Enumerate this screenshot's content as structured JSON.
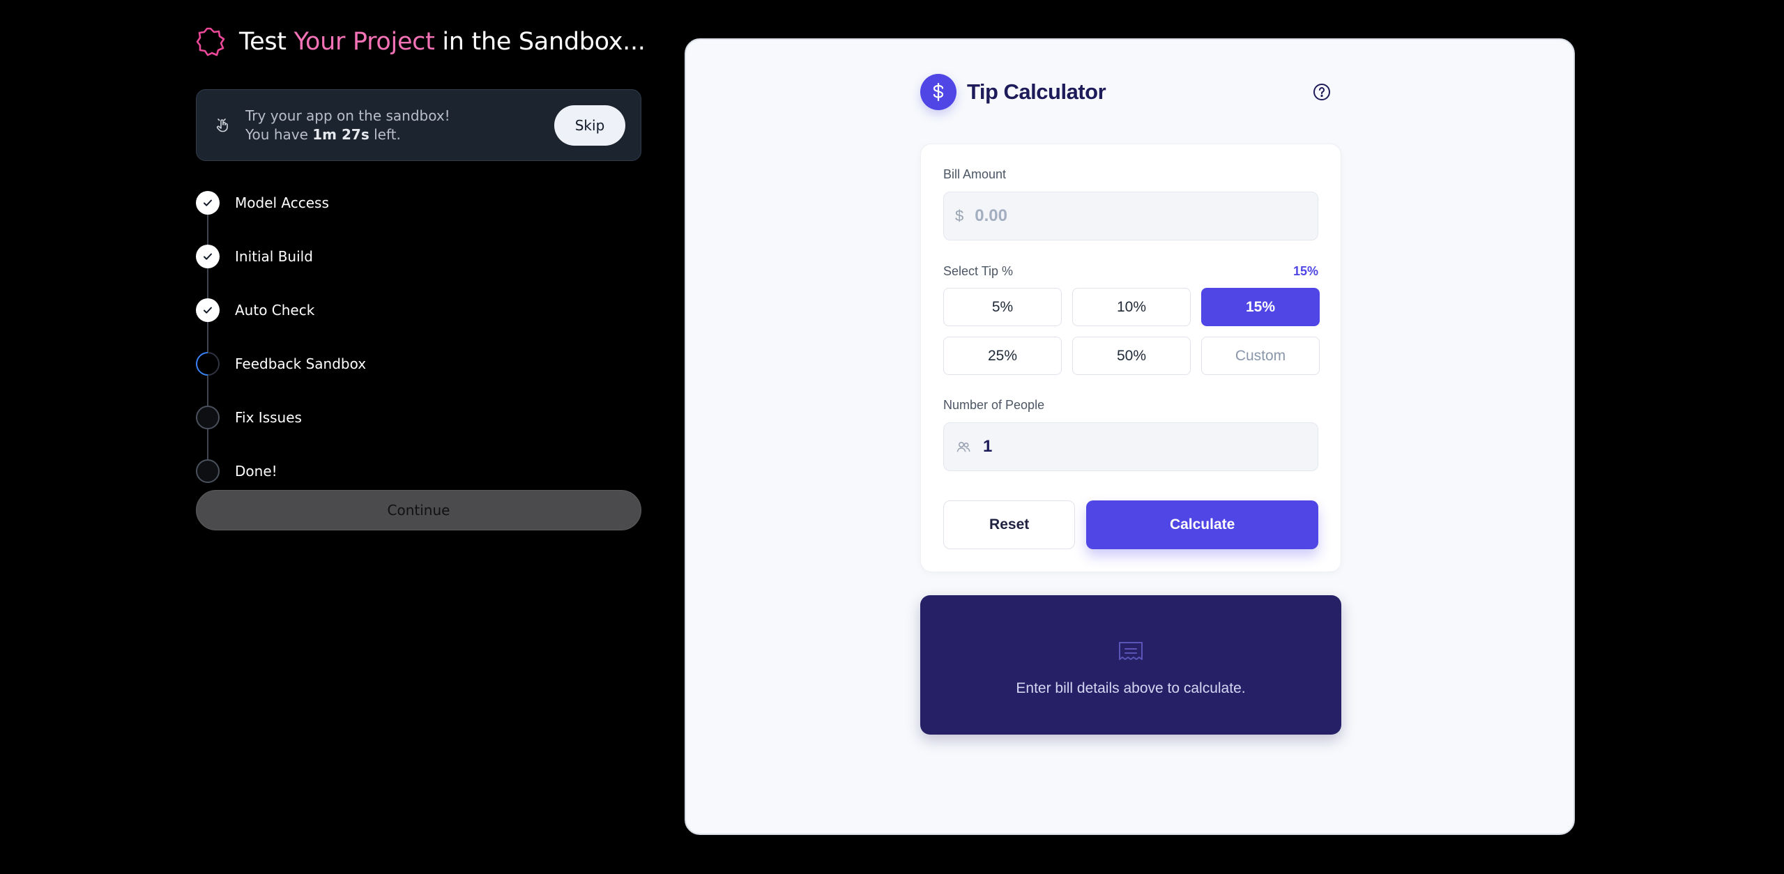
{
  "header": {
    "title_prefix": "Test ",
    "title_highlight": "Your Project",
    "title_suffix": " in the Sandbox..."
  },
  "notice": {
    "line1": "Try your app on the sandbox!",
    "line2_prefix": "You have ",
    "time_left": "1m 27s",
    "line2_suffix": " left.",
    "skip_label": "Skip"
  },
  "steps": [
    {
      "label": "Model Access",
      "status": "done"
    },
    {
      "label": "Initial Build",
      "status": "done"
    },
    {
      "label": "Auto Check",
      "status": "done"
    },
    {
      "label": "Feedback Sandbox",
      "status": "active"
    },
    {
      "label": "Fix Issues",
      "status": "pending"
    },
    {
      "label": "Done!",
      "status": "pending"
    }
  ],
  "continue_label": "Continue",
  "app": {
    "title": "Tip Calculator",
    "logo_symbol": "$",
    "bill": {
      "label": "Bill Amount",
      "currency": "$",
      "placeholder": "0.00",
      "value": ""
    },
    "tip": {
      "label": "Select Tip %",
      "selected_display": "15%",
      "options": [
        {
          "label": "5%",
          "selected": false
        },
        {
          "label": "10%",
          "selected": false
        },
        {
          "label": "15%",
          "selected": true
        },
        {
          "label": "25%",
          "selected": false
        },
        {
          "label": "50%",
          "selected": false
        },
        {
          "label": "Custom",
          "selected": false
        }
      ]
    },
    "people": {
      "label": "Number of People",
      "value": "1"
    },
    "reset_label": "Reset",
    "calculate_label": "Calculate",
    "result_message": "Enter bill details above to calculate."
  },
  "colors": {
    "accent": "#4f46e5",
    "highlight_pink": "#f472b6",
    "result_bg": "#262167",
    "active_step": "#3b82f6"
  },
  "icons": {
    "title_logo": "badge-icon",
    "notice": "pointer-hand-icon",
    "help": "question-circle-icon",
    "people": "users-icon",
    "result": "receipt-icon"
  }
}
